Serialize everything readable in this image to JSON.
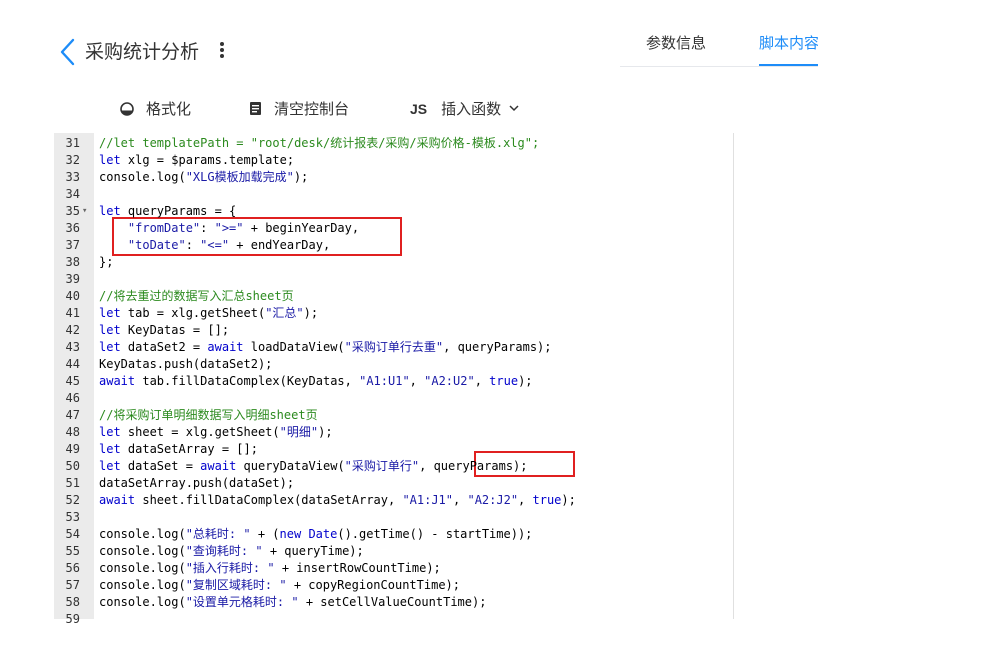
{
  "header": {
    "title": "采购统计分析",
    "tabs": [
      {
        "label": "参数信息",
        "active": false
      },
      {
        "label": "脚本内容",
        "active": true
      }
    ]
  },
  "toolbar": {
    "format_label": "格式化",
    "clear_label": "清空控制台",
    "js_badge": "JS",
    "insert_label": "插入函数"
  },
  "colors": {
    "accent": "#1d8cf8",
    "comment": "#2b8a1e",
    "string": "#1a1aa6",
    "keyword": "#0000cc",
    "highlight_box": "#e02020"
  },
  "icons": [
    "back-chevron-icon",
    "more-vertical-icon",
    "format-icon",
    "clear-console-icon",
    "chevron-down-icon",
    "fold-arrow-icon"
  ],
  "editor": {
    "fold_marker": "▾",
    "lines": [
      {
        "num": "31",
        "segments": [
          {
            "t": "//let templatePath = \"root/desk/统计报表/采购/采购价格-模板.xlg\";",
            "k": "c"
          }
        ]
      },
      {
        "num": "32",
        "segments": [
          {
            "t": "let",
            "k": "k"
          },
          {
            "t": " xlg = $params.template;",
            "k": ""
          }
        ]
      },
      {
        "num": "33",
        "segments": [
          {
            "t": "console.log(",
            "k": ""
          },
          {
            "t": "\"XLG模板加载完成\"",
            "k": "s"
          },
          {
            "t": ");",
            "k": ""
          }
        ]
      },
      {
        "num": "34",
        "segments": []
      },
      {
        "num": "35",
        "fold": true,
        "segments": [
          {
            "t": "let",
            "k": "k"
          },
          {
            "t": " queryParams = {",
            "k": ""
          }
        ]
      },
      {
        "num": "36",
        "segments": [
          {
            "t": "    ",
            "k": ""
          },
          {
            "t": "\"fromDate\"",
            "k": "s"
          },
          {
            "t": ": ",
            "k": ""
          },
          {
            "t": "\">=\"",
            "k": "s"
          },
          {
            "t": " + beginYearDay,",
            "k": ""
          }
        ]
      },
      {
        "num": "37",
        "segments": [
          {
            "t": "    ",
            "k": ""
          },
          {
            "t": "\"toDate\"",
            "k": "s"
          },
          {
            "t": ": ",
            "k": ""
          },
          {
            "t": "\"<=\"",
            "k": "s"
          },
          {
            "t": " + endYearDay,",
            "k": ""
          }
        ]
      },
      {
        "num": "38",
        "segments": [
          {
            "t": "};",
            "k": ""
          }
        ]
      },
      {
        "num": "39",
        "segments": []
      },
      {
        "num": "40",
        "segments": [
          {
            "t": "//将去重过的数据写入汇总sheet页",
            "k": "c"
          }
        ]
      },
      {
        "num": "41",
        "segments": [
          {
            "t": "let",
            "k": "k"
          },
          {
            "t": " tab = xlg.getSheet(",
            "k": ""
          },
          {
            "t": "\"汇总\"",
            "k": "s"
          },
          {
            "t": ");",
            "k": ""
          }
        ]
      },
      {
        "num": "42",
        "segments": [
          {
            "t": "let",
            "k": "k"
          },
          {
            "t": " KeyDatas = [];",
            "k": ""
          }
        ]
      },
      {
        "num": "43",
        "segments": [
          {
            "t": "let",
            "k": "k"
          },
          {
            "t": " dataSet2 = ",
            "k": ""
          },
          {
            "t": "await",
            "k": "k"
          },
          {
            "t": " loadDataView(",
            "k": ""
          },
          {
            "t": "\"采购订单行去重\"",
            "k": "s"
          },
          {
            "t": ", queryParams);",
            "k": ""
          }
        ]
      },
      {
        "num": "44",
        "segments": [
          {
            "t": "KeyDatas.push(dataSet2);",
            "k": ""
          }
        ]
      },
      {
        "num": "45",
        "segments": [
          {
            "t": "await",
            "k": "k"
          },
          {
            "t": " tab.fillDataComplex(KeyDatas, ",
            "k": ""
          },
          {
            "t": "\"A1:U1\"",
            "k": "s"
          },
          {
            "t": ", ",
            "k": ""
          },
          {
            "t": "\"A2:U2\"",
            "k": "s"
          },
          {
            "t": ", ",
            "k": ""
          },
          {
            "t": "true",
            "k": "b"
          },
          {
            "t": ");",
            "k": ""
          }
        ]
      },
      {
        "num": "46",
        "segments": []
      },
      {
        "num": "47",
        "segments": [
          {
            "t": "//将采购订单明细数据写入明细sheet页",
            "k": "c"
          }
        ]
      },
      {
        "num": "48",
        "segments": [
          {
            "t": "let",
            "k": "k"
          },
          {
            "t": " sheet = xlg.getSheet(",
            "k": ""
          },
          {
            "t": "\"明细\"",
            "k": "s"
          },
          {
            "t": ");",
            "k": ""
          }
        ]
      },
      {
        "num": "49",
        "segments": [
          {
            "t": "let",
            "k": "k"
          },
          {
            "t": " dataSetArray = [];",
            "k": ""
          }
        ]
      },
      {
        "num": "50",
        "segments": [
          {
            "t": "let",
            "k": "k"
          },
          {
            "t": " dataSet = ",
            "k": ""
          },
          {
            "t": "await",
            "k": "k"
          },
          {
            "t": " queryDataView(",
            "k": ""
          },
          {
            "t": "\"采购订单行\"",
            "k": "s"
          },
          {
            "t": ", queryParams);",
            "k": ""
          }
        ]
      },
      {
        "num": "51",
        "segments": [
          {
            "t": "dataSetArray.push(dataSet);",
            "k": ""
          }
        ]
      },
      {
        "num": "52",
        "segments": [
          {
            "t": "await",
            "k": "k"
          },
          {
            "t": " sheet.fillDataComplex(dataSetArray, ",
            "k": ""
          },
          {
            "t": "\"A1:J1\"",
            "k": "s"
          },
          {
            "t": ", ",
            "k": ""
          },
          {
            "t": "\"A2:J2\"",
            "k": "s"
          },
          {
            "t": ", ",
            "k": ""
          },
          {
            "t": "true",
            "k": "b"
          },
          {
            "t": ");",
            "k": ""
          }
        ]
      },
      {
        "num": "53",
        "segments": []
      },
      {
        "num": "54",
        "segments": [
          {
            "t": "console.log(",
            "k": ""
          },
          {
            "t": "\"总耗时: \"",
            "k": "s"
          },
          {
            "t": " + (",
            "k": ""
          },
          {
            "t": "new",
            "k": "k"
          },
          {
            "t": " ",
            "k": ""
          },
          {
            "t": "Date",
            "k": "k"
          },
          {
            "t": "().getTime() - startTime));",
            "k": ""
          }
        ]
      },
      {
        "num": "55",
        "segments": [
          {
            "t": "console.log(",
            "k": ""
          },
          {
            "t": "\"查询耗时: \"",
            "k": "s"
          },
          {
            "t": " + queryTime);",
            "k": ""
          }
        ]
      },
      {
        "num": "56",
        "segments": [
          {
            "t": "console.log(",
            "k": ""
          },
          {
            "t": "\"插入行耗时: \"",
            "k": "s"
          },
          {
            "t": " + insertRowCountTime);",
            "k": ""
          }
        ]
      },
      {
        "num": "57",
        "segments": [
          {
            "t": "console.log(",
            "k": ""
          },
          {
            "t": "\"复制区域耗时: \"",
            "k": "s"
          },
          {
            "t": " + copyRegionCountTime);",
            "k": ""
          }
        ]
      },
      {
        "num": "58",
        "segments": [
          {
            "t": "console.log(",
            "k": ""
          },
          {
            "t": "\"设置单元格耗时: \"",
            "k": "s"
          },
          {
            "t": " + setCellValueCountTime);",
            "k": ""
          }
        ]
      },
      {
        "num": "59",
        "segments": []
      }
    ]
  }
}
